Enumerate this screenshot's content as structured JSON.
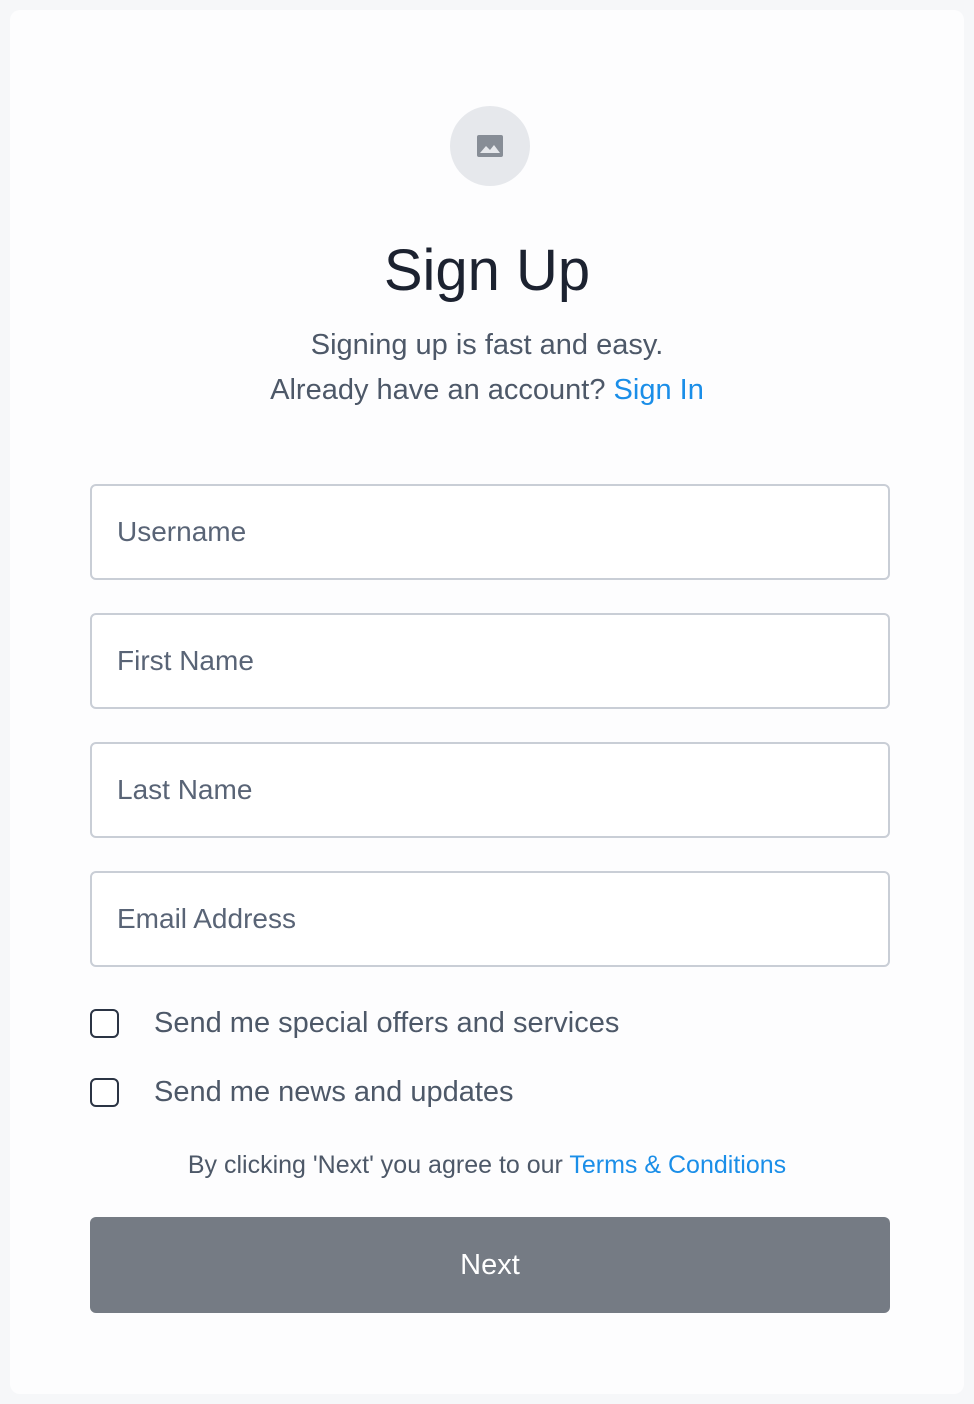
{
  "header": {
    "logo_icon": "image-placeholder-icon",
    "title": "Sign Up",
    "subtitle": "Signing up is fast and easy.",
    "signin_prompt": "Already have an account?",
    "signin_link": "Sign In"
  },
  "form": {
    "fields": [
      {
        "placeholder": "Username",
        "value": ""
      },
      {
        "placeholder": "First Name",
        "value": ""
      },
      {
        "placeholder": "Last Name",
        "value": ""
      },
      {
        "placeholder": "Email Address",
        "value": ""
      }
    ],
    "checkboxes": [
      {
        "label": "Send me special offers and services",
        "checked": false
      },
      {
        "label": "Send me news and updates",
        "checked": false
      }
    ],
    "terms_prefix": "By clicking 'Next' you agree to our",
    "terms_link": "Terms & Conditions",
    "submit_label": "Next"
  },
  "colors": {
    "accent": "#1a8ee8",
    "button": "#757b84",
    "text": "#4d5868",
    "title": "#1c2230"
  }
}
